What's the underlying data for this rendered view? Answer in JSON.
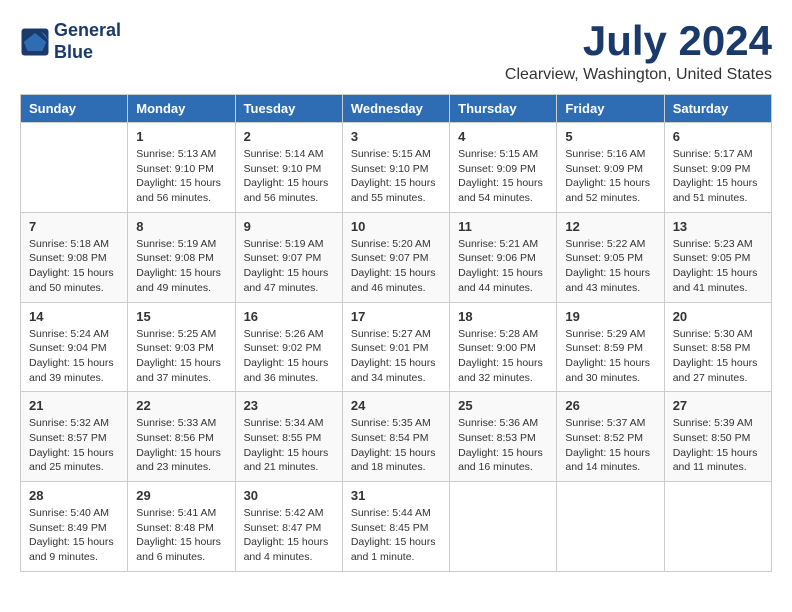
{
  "logo": {
    "line1": "General",
    "line2": "Blue"
  },
  "title": "July 2024",
  "subtitle": "Clearview, Washington, United States",
  "weekdays": [
    "Sunday",
    "Monday",
    "Tuesday",
    "Wednesday",
    "Thursday",
    "Friday",
    "Saturday"
  ],
  "weeks": [
    [
      {
        "day": "",
        "info": ""
      },
      {
        "day": "1",
        "info": "Sunrise: 5:13 AM\nSunset: 9:10 PM\nDaylight: 15 hours\nand 56 minutes."
      },
      {
        "day": "2",
        "info": "Sunrise: 5:14 AM\nSunset: 9:10 PM\nDaylight: 15 hours\nand 56 minutes."
      },
      {
        "day": "3",
        "info": "Sunrise: 5:15 AM\nSunset: 9:10 PM\nDaylight: 15 hours\nand 55 minutes."
      },
      {
        "day": "4",
        "info": "Sunrise: 5:15 AM\nSunset: 9:09 PM\nDaylight: 15 hours\nand 54 minutes."
      },
      {
        "day": "5",
        "info": "Sunrise: 5:16 AM\nSunset: 9:09 PM\nDaylight: 15 hours\nand 52 minutes."
      },
      {
        "day": "6",
        "info": "Sunrise: 5:17 AM\nSunset: 9:09 PM\nDaylight: 15 hours\nand 51 minutes."
      }
    ],
    [
      {
        "day": "7",
        "info": "Sunrise: 5:18 AM\nSunset: 9:08 PM\nDaylight: 15 hours\nand 50 minutes."
      },
      {
        "day": "8",
        "info": "Sunrise: 5:19 AM\nSunset: 9:08 PM\nDaylight: 15 hours\nand 49 minutes."
      },
      {
        "day": "9",
        "info": "Sunrise: 5:19 AM\nSunset: 9:07 PM\nDaylight: 15 hours\nand 47 minutes."
      },
      {
        "day": "10",
        "info": "Sunrise: 5:20 AM\nSunset: 9:07 PM\nDaylight: 15 hours\nand 46 minutes."
      },
      {
        "day": "11",
        "info": "Sunrise: 5:21 AM\nSunset: 9:06 PM\nDaylight: 15 hours\nand 44 minutes."
      },
      {
        "day": "12",
        "info": "Sunrise: 5:22 AM\nSunset: 9:05 PM\nDaylight: 15 hours\nand 43 minutes."
      },
      {
        "day": "13",
        "info": "Sunrise: 5:23 AM\nSunset: 9:05 PM\nDaylight: 15 hours\nand 41 minutes."
      }
    ],
    [
      {
        "day": "14",
        "info": "Sunrise: 5:24 AM\nSunset: 9:04 PM\nDaylight: 15 hours\nand 39 minutes."
      },
      {
        "day": "15",
        "info": "Sunrise: 5:25 AM\nSunset: 9:03 PM\nDaylight: 15 hours\nand 37 minutes."
      },
      {
        "day": "16",
        "info": "Sunrise: 5:26 AM\nSunset: 9:02 PM\nDaylight: 15 hours\nand 36 minutes."
      },
      {
        "day": "17",
        "info": "Sunrise: 5:27 AM\nSunset: 9:01 PM\nDaylight: 15 hours\nand 34 minutes."
      },
      {
        "day": "18",
        "info": "Sunrise: 5:28 AM\nSunset: 9:00 PM\nDaylight: 15 hours\nand 32 minutes."
      },
      {
        "day": "19",
        "info": "Sunrise: 5:29 AM\nSunset: 8:59 PM\nDaylight: 15 hours\nand 30 minutes."
      },
      {
        "day": "20",
        "info": "Sunrise: 5:30 AM\nSunset: 8:58 PM\nDaylight: 15 hours\nand 27 minutes."
      }
    ],
    [
      {
        "day": "21",
        "info": "Sunrise: 5:32 AM\nSunset: 8:57 PM\nDaylight: 15 hours\nand 25 minutes."
      },
      {
        "day": "22",
        "info": "Sunrise: 5:33 AM\nSunset: 8:56 PM\nDaylight: 15 hours\nand 23 minutes."
      },
      {
        "day": "23",
        "info": "Sunrise: 5:34 AM\nSunset: 8:55 PM\nDaylight: 15 hours\nand 21 minutes."
      },
      {
        "day": "24",
        "info": "Sunrise: 5:35 AM\nSunset: 8:54 PM\nDaylight: 15 hours\nand 18 minutes."
      },
      {
        "day": "25",
        "info": "Sunrise: 5:36 AM\nSunset: 8:53 PM\nDaylight: 15 hours\nand 16 minutes."
      },
      {
        "day": "26",
        "info": "Sunrise: 5:37 AM\nSunset: 8:52 PM\nDaylight: 15 hours\nand 14 minutes."
      },
      {
        "day": "27",
        "info": "Sunrise: 5:39 AM\nSunset: 8:50 PM\nDaylight: 15 hours\nand 11 minutes."
      }
    ],
    [
      {
        "day": "28",
        "info": "Sunrise: 5:40 AM\nSunset: 8:49 PM\nDaylight: 15 hours\nand 9 minutes."
      },
      {
        "day": "29",
        "info": "Sunrise: 5:41 AM\nSunset: 8:48 PM\nDaylight: 15 hours\nand 6 minutes."
      },
      {
        "day": "30",
        "info": "Sunrise: 5:42 AM\nSunset: 8:47 PM\nDaylight: 15 hours\nand 4 minutes."
      },
      {
        "day": "31",
        "info": "Sunrise: 5:44 AM\nSunset: 8:45 PM\nDaylight: 15 hours\nand 1 minute."
      },
      {
        "day": "",
        "info": ""
      },
      {
        "day": "",
        "info": ""
      },
      {
        "day": "",
        "info": ""
      }
    ]
  ]
}
